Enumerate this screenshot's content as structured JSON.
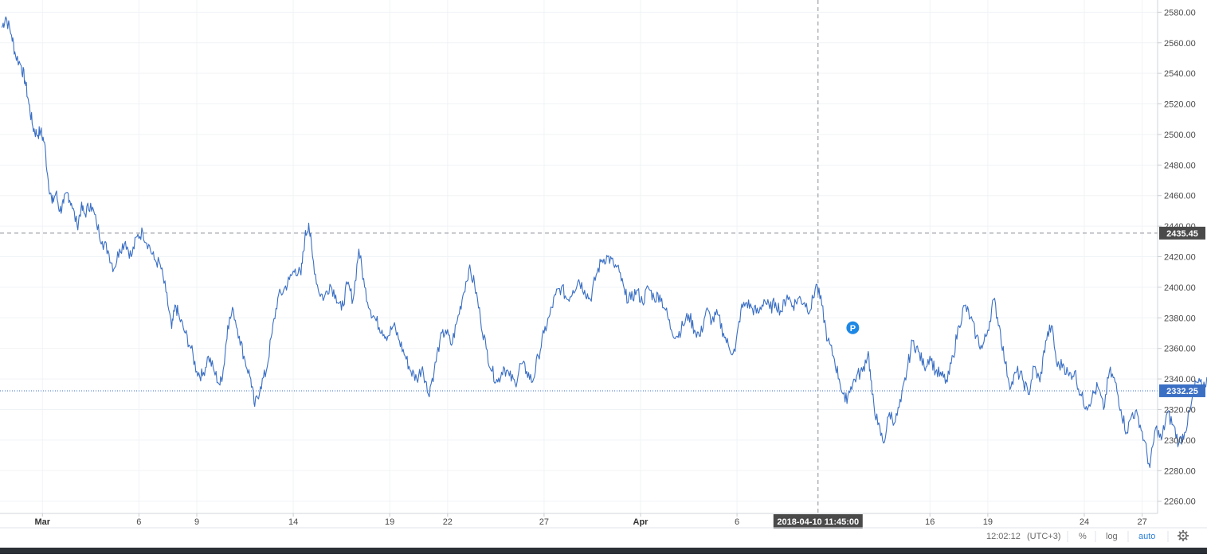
{
  "chart_data": {
    "type": "line",
    "title": "",
    "xlabel": "",
    "ylabel": "",
    "ylim": [
      2252,
      2588
    ],
    "y_ticks": [
      "2580.00",
      "2560.00",
      "2540.00",
      "2520.00",
      "2500.00",
      "2480.00",
      "2460.00",
      "2440.00",
      "2420.00",
      "2400.00",
      "2380.00",
      "2360.00",
      "2340.00",
      "2320.00",
      "2300.00",
      "2280.00",
      "2260.00"
    ],
    "x_ticks": [
      {
        "label": "Mar",
        "day": 0,
        "bold": true
      },
      {
        "label": "6",
        "day": 5,
        "bold": false
      },
      {
        "label": "9",
        "day": 8,
        "bold": false
      },
      {
        "label": "14",
        "day": 13,
        "bold": false
      },
      {
        "label": "19",
        "day": 18,
        "bold": false
      },
      {
        "label": "22",
        "day": 21,
        "bold": false
      },
      {
        "label": "27",
        "day": 26,
        "bold": false
      },
      {
        "label": "Apr",
        "day": 31,
        "bold": true
      },
      {
        "label": "6",
        "day": 36,
        "bold": false
      },
      {
        "label": "16",
        "day": 46,
        "bold": false
      },
      {
        "label": "19",
        "day": 49,
        "bold": false
      },
      {
        "label": "24",
        "day": 54,
        "bold": false
      },
      {
        "label": "27",
        "day": 57,
        "bold": false
      }
    ],
    "x_domain": [
      -2.2,
      57.8
    ],
    "series": [
      {
        "color": "#3a6fc4",
        "points": [
          [
            -2.1,
            2570
          ],
          [
            -1.9,
            2577
          ],
          [
            -1.6,
            2565
          ],
          [
            -1.4,
            2552
          ],
          [
            -1.1,
            2545
          ],
          [
            -0.9,
            2535
          ],
          [
            -0.7,
            2520
          ],
          [
            -0.5,
            2505
          ],
          [
            -0.3,
            2500
          ],
          [
            -0.1,
            2502
          ],
          [
            0.1,
            2495
          ],
          [
            0.3,
            2470
          ],
          [
            0.5,
            2455
          ],
          [
            0.7,
            2462
          ],
          [
            0.9,
            2450
          ],
          [
            1.1,
            2455
          ],
          [
            1.3,
            2462
          ],
          [
            1.5,
            2455
          ],
          [
            1.8,
            2440
          ],
          [
            2.0,
            2452
          ],
          [
            2.2,
            2448
          ],
          [
            2.5,
            2455
          ],
          [
            2.8,
            2442
          ],
          [
            3.1,
            2430
          ],
          [
            3.4,
            2424
          ],
          [
            3.7,
            2412
          ],
          [
            4.0,
            2425
          ],
          [
            4.3,
            2430
          ],
          [
            4.6,
            2420
          ],
          [
            4.9,
            2433
          ],
          [
            5.2,
            2436
          ],
          [
            5.5,
            2428
          ],
          [
            5.8,
            2418
          ],
          [
            6.1,
            2415
          ],
          [
            6.4,
            2397
          ],
          [
            6.7,
            2373
          ],
          [
            6.9,
            2388
          ],
          [
            7.1,
            2380
          ],
          [
            7.4,
            2370
          ],
          [
            7.7,
            2360
          ],
          [
            8.0,
            2345
          ],
          [
            8.3,
            2342
          ],
          [
            8.6,
            2355
          ],
          [
            8.9,
            2345
          ],
          [
            9.2,
            2336
          ],
          [
            9.4,
            2348
          ],
          [
            9.6,
            2375
          ],
          [
            9.9,
            2385
          ],
          [
            10.2,
            2368
          ],
          [
            10.5,
            2352
          ],
          [
            10.8,
            2340
          ],
          [
            11.0,
            2322
          ],
          [
            11.3,
            2335
          ],
          [
            11.6,
            2345
          ],
          [
            11.9,
            2370
          ],
          [
            12.2,
            2393
          ],
          [
            12.5,
            2398
          ],
          [
            12.8,
            2405
          ],
          [
            13.1,
            2412
          ],
          [
            13.4,
            2408
          ],
          [
            13.6,
            2432
          ],
          [
            13.8,
            2442
          ],
          [
            14.0,
            2420
          ],
          [
            14.3,
            2398
          ],
          [
            14.6,
            2393
          ],
          [
            14.9,
            2402
          ],
          [
            15.2,
            2395
          ],
          [
            15.5,
            2385
          ],
          [
            15.8,
            2402
          ],
          [
            16.1,
            2392
          ],
          [
            16.4,
            2425
          ],
          [
            16.7,
            2400
          ],
          [
            17.0,
            2385
          ],
          [
            17.3,
            2378
          ],
          [
            17.6,
            2372
          ],
          [
            17.9,
            2368
          ],
          [
            18.2,
            2375
          ],
          [
            18.5,
            2365
          ],
          [
            18.8,
            2355
          ],
          [
            19.1,
            2345
          ],
          [
            19.4,
            2340
          ],
          [
            19.7,
            2348
          ],
          [
            20.0,
            2330
          ],
          [
            20.3,
            2345
          ],
          [
            20.6,
            2365
          ],
          [
            20.9,
            2372
          ],
          [
            21.2,
            2362
          ],
          [
            21.5,
            2378
          ],
          [
            21.8,
            2395
          ],
          [
            22.1,
            2412
          ],
          [
            22.4,
            2402
          ],
          [
            22.7,
            2380
          ],
          [
            23.0,
            2360
          ],
          [
            23.3,
            2345
          ],
          [
            23.6,
            2338
          ],
          [
            23.9,
            2348
          ],
          [
            24.2,
            2342
          ],
          [
            24.5,
            2337
          ],
          [
            24.8,
            2350
          ],
          [
            25.1,
            2345
          ],
          [
            25.4,
            2338
          ],
          [
            25.7,
            2355
          ],
          [
            26.0,
            2370
          ],
          [
            26.3,
            2382
          ],
          [
            26.6,
            2395
          ],
          [
            26.9,
            2400
          ],
          [
            27.2,
            2392
          ],
          [
            27.5,
            2398
          ],
          [
            27.8,
            2405
          ],
          [
            28.1,
            2398
          ],
          [
            28.4,
            2392
          ],
          [
            28.7,
            2408
          ],
          [
            29.0,
            2418
          ],
          [
            29.3,
            2420
          ],
          [
            29.6,
            2415
          ],
          [
            29.9,
            2410
          ],
          [
            30.2,
            2395
          ],
          [
            30.5,
            2392
          ],
          [
            30.8,
            2398
          ],
          [
            31.1,
            2390
          ],
          [
            31.4,
            2400
          ],
          [
            31.7,
            2393
          ],
          [
            32.0,
            2395
          ],
          [
            32.3,
            2385
          ],
          [
            32.6,
            2372
          ],
          [
            32.9,
            2368
          ],
          [
            33.2,
            2375
          ],
          [
            33.5,
            2382
          ],
          [
            33.8,
            2372
          ],
          [
            34.1,
            2368
          ],
          [
            34.4,
            2385
          ],
          [
            34.7,
            2378
          ],
          [
            35.0,
            2382
          ],
          [
            35.3,
            2370
          ],
          [
            35.6,
            2360
          ],
          [
            35.9,
            2358
          ],
          [
            36.2,
            2385
          ],
          [
            36.5,
            2390
          ],
          [
            36.8,
            2386
          ],
          [
            37.1,
            2383
          ],
          [
            37.4,
            2392
          ],
          [
            37.7,
            2386
          ],
          [
            38.0,
            2390
          ],
          [
            38.3,
            2384
          ],
          [
            38.6,
            2395
          ],
          [
            38.9,
            2388
          ],
          [
            39.2,
            2393
          ],
          [
            39.5,
            2390
          ],
          [
            39.8,
            2385
          ],
          [
            40.1,
            2402
          ],
          [
            40.4,
            2388
          ],
          [
            40.7,
            2365
          ],
          [
            41.0,
            2355
          ],
          [
            41.3,
            2340
          ],
          [
            41.6,
            2325
          ],
          [
            41.9,
            2335
          ],
          [
            42.2,
            2342
          ],
          [
            42.5,
            2345
          ],
          [
            42.8,
            2358
          ],
          [
            43.0,
            2330
          ],
          [
            43.3,
            2310
          ],
          [
            43.6,
            2298
          ],
          [
            43.9,
            2318
          ],
          [
            44.2,
            2312
          ],
          [
            44.5,
            2325
          ],
          [
            44.8,
            2345
          ],
          [
            45.1,
            2365
          ],
          [
            45.4,
            2358
          ],
          [
            45.7,
            2348
          ],
          [
            46.0,
            2355
          ],
          [
            46.3,
            2345
          ],
          [
            46.6,
            2342
          ],
          [
            46.9,
            2338
          ],
          [
            47.2,
            2355
          ],
          [
            47.5,
            2375
          ],
          [
            47.8,
            2388
          ],
          [
            48.1,
            2380
          ],
          [
            48.4,
            2368
          ],
          [
            48.7,
            2360
          ],
          [
            49.0,
            2372
          ],
          [
            49.3,
            2392
          ],
          [
            49.6,
            2375
          ],
          [
            49.9,
            2350
          ],
          [
            50.2,
            2335
          ],
          [
            50.5,
            2345
          ],
          [
            50.8,
            2340
          ],
          [
            51.1,
            2330
          ],
          [
            51.4,
            2348
          ],
          [
            51.7,
            2338
          ],
          [
            52.0,
            2365
          ],
          [
            52.3,
            2375
          ],
          [
            52.6,
            2348
          ],
          [
            52.9,
            2350
          ],
          [
            53.2,
            2342
          ],
          [
            53.5,
            2345
          ],
          [
            53.8,
            2330
          ],
          [
            54.1,
            2322
          ],
          [
            54.4,
            2328
          ],
          [
            54.7,
            2335
          ],
          [
            55.0,
            2320
          ],
          [
            55.3,
            2345
          ],
          [
            55.6,
            2338
          ],
          [
            55.9,
            2320
          ],
          [
            56.2,
            2305
          ],
          [
            56.5,
            2318
          ],
          [
            56.8,
            2315
          ],
          [
            57.1,
            2300
          ],
          [
            57.4,
            2282
          ],
          [
            57.7,
            2308
          ],
          [
            58.0,
            2300
          ],
          [
            58.3,
            2318
          ],
          [
            58.6,
            2310
          ],
          [
            58.9,
            2298
          ],
          [
            59.2,
            2305
          ],
          [
            59.5,
            2320
          ],
          [
            59.8,
            2338
          ],
          [
            60.1,
            2335
          ],
          [
            60.4,
            2340
          ],
          [
            60.7,
            2333
          ]
        ]
      }
    ],
    "last_price_label": "2332.25",
    "last_price_value": 2332.25,
    "crosshair_price_label": "2435.45",
    "crosshair_price_value": 2435.45,
    "crosshair_time_label": "2018-04-10 11:45:00",
    "crosshair_day": 40.2,
    "marker": {
      "label": "P",
      "day": 42.0,
      "value": 2373.5
    }
  },
  "status_bar": {
    "time": "12:02:12",
    "timezone": "(UTC+3)",
    "percent_label": "%",
    "log_label": "log",
    "auto_label": "auto",
    "settings_icon": "gear-icon"
  },
  "colors": {
    "line": "#3a6fc4",
    "grid": "#f0f3f6",
    "last_price_badge": "#3a6fc4",
    "crosshair_badge": "#4a4a4a"
  }
}
